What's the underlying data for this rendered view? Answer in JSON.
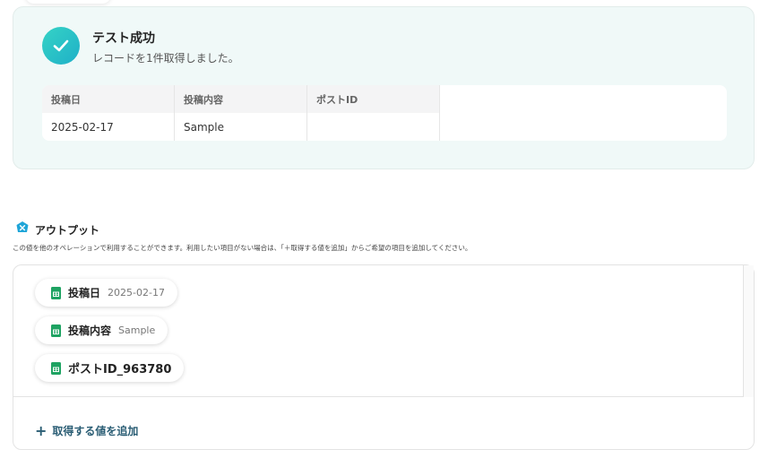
{
  "result": {
    "title": "テスト成功",
    "subtitle": "レコードを1件取得しました。",
    "table": {
      "headers": [
        "投稿日",
        "投稿内容",
        "ポストID"
      ],
      "rows": [
        [
          "2025-02-17",
          "Sample",
          ""
        ]
      ]
    }
  },
  "output": {
    "title": "アウトプット",
    "description": "この値を他のオペレーションで利用することができます。利用したい項目がない場合は、「＋取得する値を追加」からご希望の項目を追加してください。",
    "chips": [
      {
        "key": "投稿日",
        "value": "2025-02-17"
      },
      {
        "key": "投稿内容",
        "value": "Sample"
      },
      {
        "key": "ポストID_963780",
        "value": ""
      }
    ],
    "add_label": "取得する値を追加",
    "add_icon": "plus-icon"
  },
  "colors": {
    "accent": "#2a5d74",
    "success": "#2cc4c6",
    "card_bg": "#f0f9f8",
    "sheet_green": "#1ea362"
  }
}
